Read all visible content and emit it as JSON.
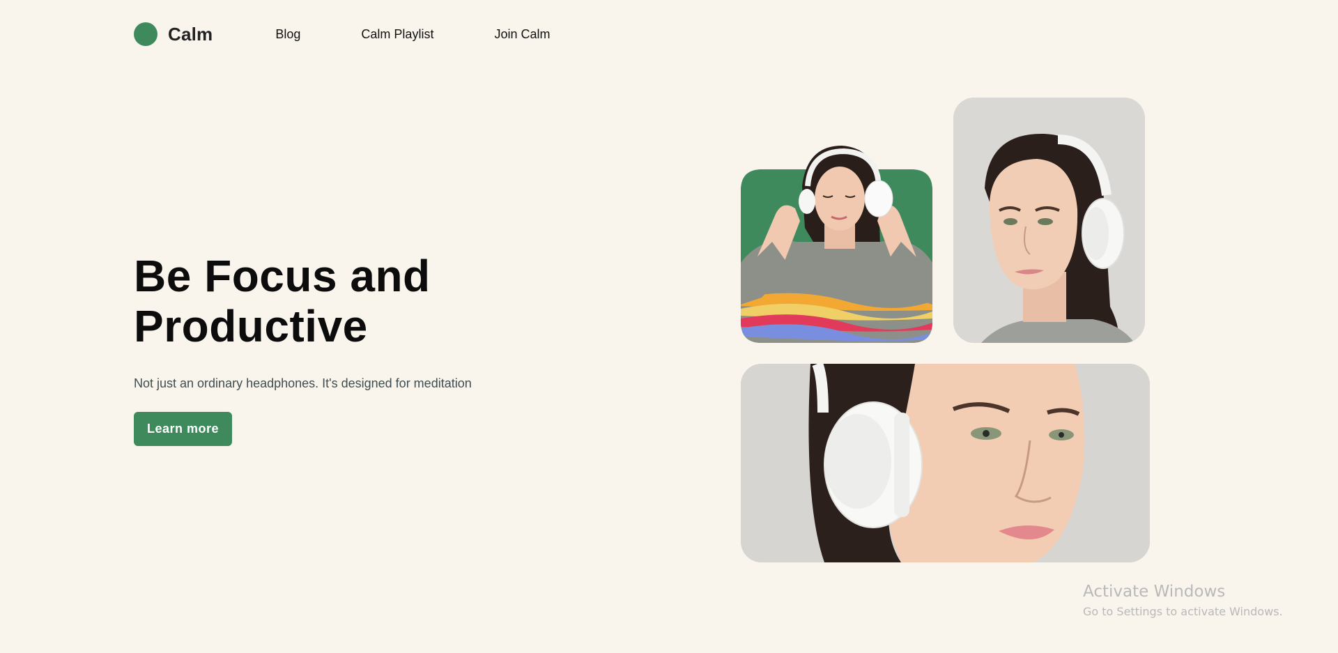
{
  "brand": {
    "name": "Calm",
    "accent_color": "#3e8a5c",
    "background_color": "#f9f4ec"
  },
  "nav": {
    "items": [
      {
        "label": "Blog"
      },
      {
        "label": "Calm Playlist"
      },
      {
        "label": "Join Calm"
      }
    ]
  },
  "hero": {
    "title_line1": "Be Focus and",
    "title_line2": "Productive",
    "subtitle": "Not just an ordinary headphones. It's designed for meditation",
    "cta_label": "Learn more"
  },
  "gallery": {
    "images": [
      {
        "subject": "woman-in-striped-sweater-with-headphones"
      },
      {
        "subject": "woman-profile-with-white-headphones"
      },
      {
        "subject": "woman-closeup-with-white-headphones"
      }
    ]
  },
  "watermark": {
    "title": "Activate Windows",
    "subtitle": "Go to Settings to activate Windows."
  }
}
